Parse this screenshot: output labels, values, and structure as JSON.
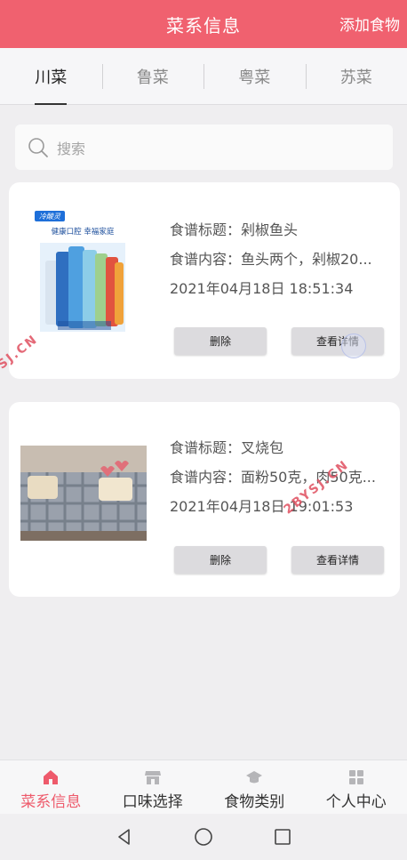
{
  "header": {
    "title": "菜系信息",
    "add_label": "添加食物"
  },
  "tabs": [
    {
      "label": "川菜",
      "active": true
    },
    {
      "label": "鲁菜",
      "active": false
    },
    {
      "label": "粤菜",
      "active": false
    },
    {
      "label": "苏菜",
      "active": false
    }
  ],
  "search": {
    "placeholder": "搜索"
  },
  "recipes": [
    {
      "title_line": "食谱标题：剁椒鱼头",
      "content_line": "食谱内容：鱼头两个，剁椒20...",
      "time": "2021年04月18日 18:51:34",
      "image": "toothpaste-product-photo",
      "image_text": {
        "brand": "冷酸灵",
        "slogan": "健康口腔 幸福家庭"
      },
      "delete_label": "删除",
      "detail_label": "查看详情"
    },
    {
      "title_line": "食谱标题：叉烧包",
      "content_line": "食谱内容：面粉50克，肉50克...",
      "time": "2021年04月18日 19:01:53",
      "image": "plaid-sofa-photo",
      "delete_label": "删除",
      "detail_label": "查看详情"
    }
  ],
  "watermarks": [
    "2BYSJ.CN",
    "SJ.CN"
  ],
  "bottom_nav": [
    {
      "label": "菜系信息",
      "icon": "home-icon",
      "active": true
    },
    {
      "label": "口味选择",
      "icon": "store-icon",
      "active": false
    },
    {
      "label": "食物类别",
      "icon": "graduation-cap-icon",
      "active": false
    },
    {
      "label": "个人中心",
      "icon": "grid-icon",
      "active": false
    }
  ],
  "colors": {
    "accent": "#f0616f",
    "nav_active": "#ee5a6b",
    "background": "#efeef0"
  }
}
